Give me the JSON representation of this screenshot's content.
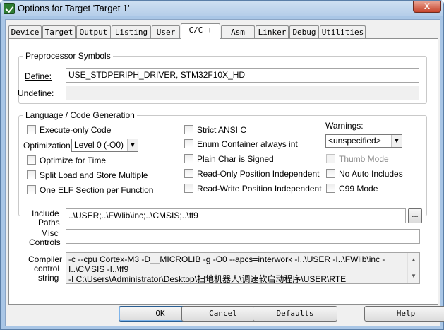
{
  "window": {
    "title": "Options for Target 'Target 1'",
    "close_label": "X"
  },
  "tabs": [
    {
      "label": "Device"
    },
    {
      "label": "Target"
    },
    {
      "label": "Output"
    },
    {
      "label": "Listing"
    },
    {
      "label": "User"
    },
    {
      "label": "C/C++"
    },
    {
      "label": "Asm"
    },
    {
      "label": "Linker"
    },
    {
      "label": "Debug"
    },
    {
      "label": "Utilities"
    }
  ],
  "active_tab": "C/C++",
  "preprocessor": {
    "legend": "Preprocessor Symbols",
    "define_label": "Define:",
    "define_value": "USE_STDPERIPH_DRIVER, STM32F10X_HD",
    "undefine_label": "Undefine:",
    "undefine_value": ""
  },
  "language": {
    "legend": "Language / Code Generation",
    "execute_only": {
      "label": "Execute-only Code",
      "checked": false
    },
    "optimization_label": "Optimization:",
    "optimization_value": "Level 0 (-O0)",
    "optimize_time": {
      "label": "Optimize for Time",
      "checked": false
    },
    "split_load": {
      "label": "Split Load and Store Multiple",
      "checked": false
    },
    "one_elf": {
      "label": "One ELF Section per Function",
      "checked": false
    },
    "strict_ansi": {
      "label": "Strict ANSI C",
      "checked": false
    },
    "enum_container": {
      "label": "Enum Container always int",
      "checked": false
    },
    "plain_char": {
      "label": "Plain Char is Signed",
      "checked": false
    },
    "ro_pi": {
      "label": "Read-Only Position Independent",
      "checked": false
    },
    "rw_pi": {
      "label": "Read-Write Position Independent",
      "checked": false
    },
    "warnings_label": "Warnings:",
    "warnings_value": "<unspecified>",
    "thumb_mode": {
      "label": "Thumb Mode",
      "checked": false,
      "disabled": true
    },
    "no_auto_includes": {
      "label": "No Auto Includes",
      "checked": false
    },
    "c99_mode": {
      "label": "C99 Mode",
      "checked": false
    }
  },
  "include": {
    "label_line1": "Include",
    "label_line2": "Paths",
    "value": "..\\USER;..\\FWlib\\inc;..\\CMSIS;..\\ff9",
    "browse_label": "..."
  },
  "misc": {
    "label_line1": "Misc",
    "label_line2": "Controls",
    "value": ""
  },
  "compiler": {
    "label_line1": "Compiler",
    "label_line2": "control",
    "label_line3": "string",
    "line1": "-c --cpu Cortex-M3 -D__MICROLIB -g -O0 --apcs=interwork -I..\\USER -I..\\FWlib\\inc -I..\\CMSIS -I..\\ff9",
    "line2": "-I C:\\Users\\Administrator\\Desktop\\扫地机器人\\调速软启动程序\\USER\\RTE"
  },
  "buttons": {
    "ok": "OK",
    "cancel": "Cancel",
    "defaults": "Defaults",
    "help": "Help"
  }
}
